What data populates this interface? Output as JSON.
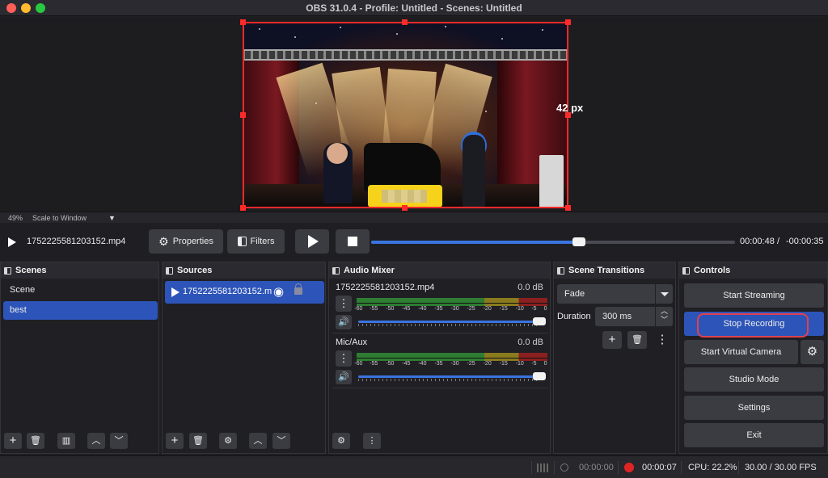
{
  "window": {
    "title": "OBS 31.0.4 - Profile: Untitled - Scenes: Untitled"
  },
  "preview": {
    "overlay_label": "42 px"
  },
  "zoom": {
    "percent": "49%",
    "mode": "Scale to Window"
  },
  "media": {
    "file_name": "1752225581203152.mp4",
    "properties_label": "Properties",
    "filters_label": "Filters",
    "progress": 0.57,
    "current_time": "00:00:48",
    "separator": "/",
    "remaining_time": "-00:00:35"
  },
  "scenes": {
    "title": "Scenes",
    "items": [
      "Scene",
      "best"
    ],
    "selected_index": 1
  },
  "sources": {
    "title": "Sources",
    "items": [
      {
        "name": "1752225581203152.m"
      }
    ]
  },
  "mixer": {
    "title": "Audio Mixer",
    "scale": [
      "-60",
      "-55",
      "-50",
      "-45",
      "-40",
      "-35",
      "-30",
      "-25",
      "-20",
      "-15",
      "-10",
      "-5",
      "0"
    ],
    "channels": [
      {
        "name": "1752225581203152.mp4",
        "db": "0.0 dB",
        "volume": 1.0
      },
      {
        "name": "Mic/Aux",
        "db": "0.0 dB",
        "volume": 1.0
      }
    ]
  },
  "transitions": {
    "title": "Scene Transitions",
    "selected": "Fade",
    "duration_label": "Duration",
    "duration_value": "300 ms"
  },
  "controls": {
    "title": "Controls",
    "start_streaming": "Start Streaming",
    "stop_recording": "Stop Recording",
    "start_virtual_camera": "Start Virtual Camera",
    "studio_mode": "Studio Mode",
    "settings": "Settings",
    "exit": "Exit"
  },
  "status": {
    "stream_time": "00:00:00",
    "record_time": "00:00:07",
    "cpu": "CPU: 22.2%",
    "fps": "30.00 / 30.00 FPS"
  },
  "colors": {
    "accent_blue": "#2d54b8",
    "record_red": "#e02424",
    "selection_red": "#ff2a2a"
  }
}
